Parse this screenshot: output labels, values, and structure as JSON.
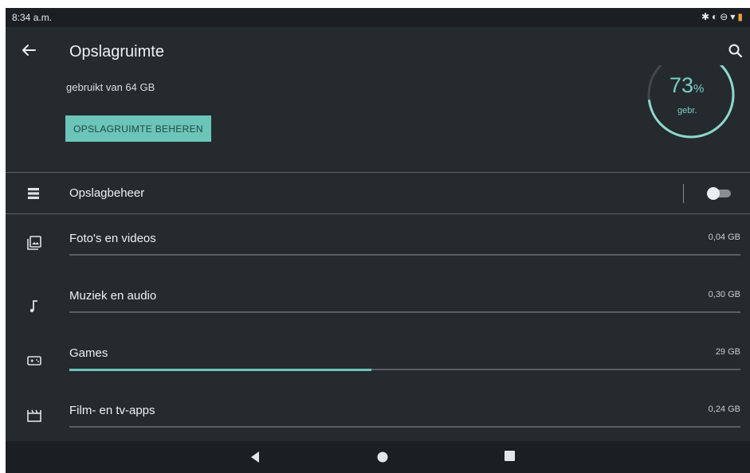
{
  "status": {
    "time": "8:34 a.m.",
    "icons": [
      "bluetooth-icon",
      "data-saver-icon",
      "dnd-icon",
      "wifi-icon",
      "battery-icon"
    ]
  },
  "header": {
    "title": "Opslagruimte"
  },
  "summary": {
    "used_text": "gebruikt van 64 GB",
    "manage_button": "OPSLAGRUIMTE BEHEREN",
    "percent": "73",
    "percent_unit": "%",
    "percent_label": "gebr.",
    "used_fraction": 0.73
  },
  "storage_manager": {
    "label": "Opslagbeheer",
    "enabled": false
  },
  "categories": [
    {
      "label": "Foto's en videos",
      "size": "0,04 GB",
      "fraction": 0.0
    },
    {
      "label": "Muziek en audio",
      "size": "0,30 GB",
      "fraction": 0.0
    },
    {
      "label": "Games",
      "size": "29 GB",
      "fraction": 0.45
    },
    {
      "label": "Film- en tv-apps",
      "size": "0,24 GB",
      "fraction": 0.0
    }
  ],
  "colors": {
    "accent": "#6cc5b9",
    "background": "#252a2f",
    "bar_track": "#5a5f64"
  }
}
